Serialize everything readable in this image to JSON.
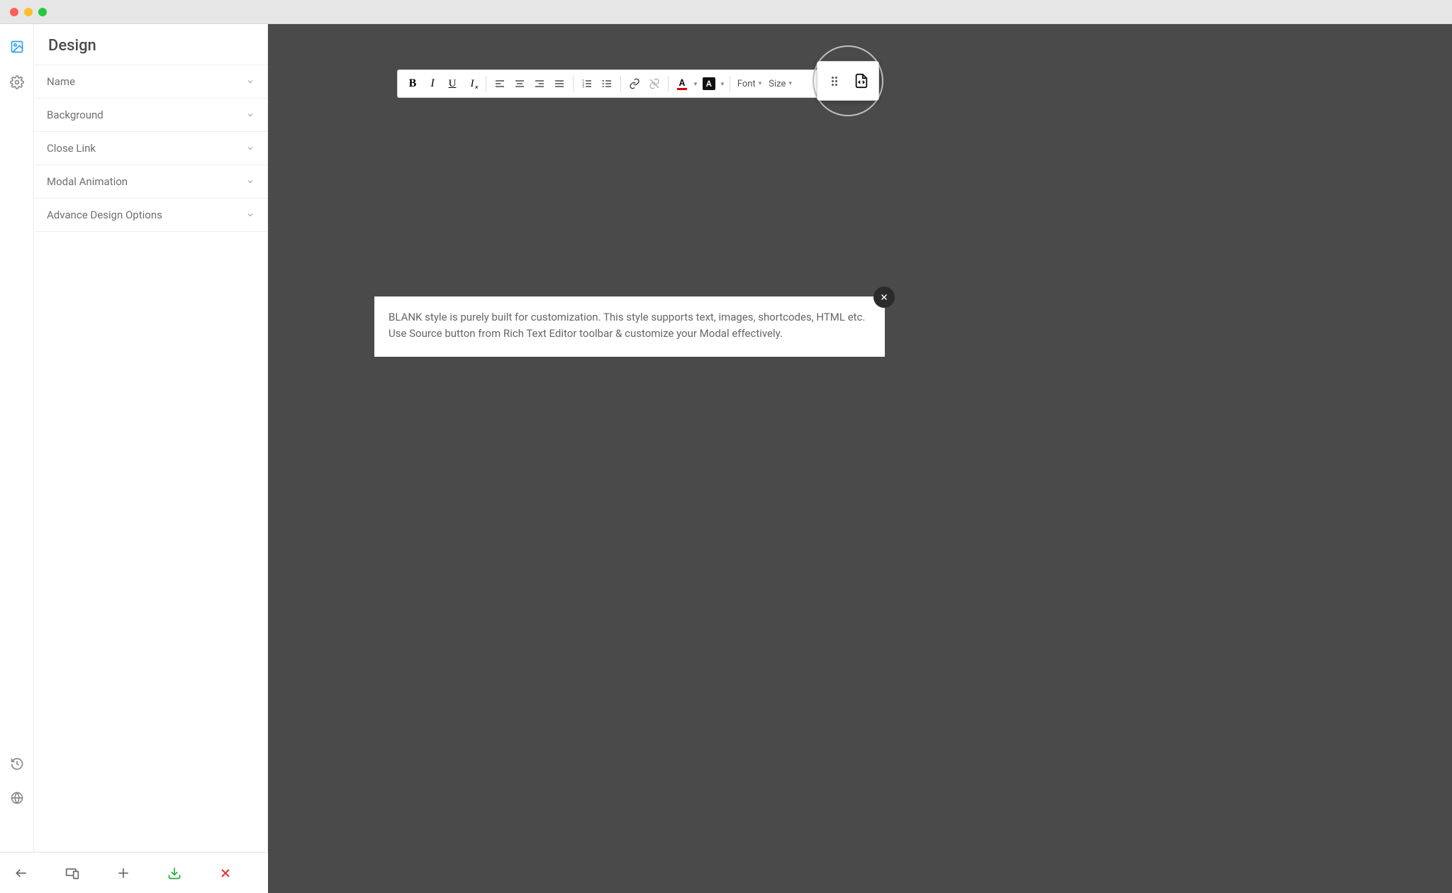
{
  "sidebar": {
    "title": "Design",
    "items": [
      {
        "label": "Name"
      },
      {
        "label": "Background"
      },
      {
        "label": "Close Link"
      },
      {
        "label": "Modal Animation"
      },
      {
        "label": "Advance Design Options"
      }
    ]
  },
  "toolbar": {
    "font_label": "Font",
    "size_label": "Size"
  },
  "modal": {
    "text": "BLANK style is purely built for customization. This style supports text, images, shortcodes, HTML etc. Use Source button from Rich Text Editor toolbar & customize your Modal effectively."
  }
}
